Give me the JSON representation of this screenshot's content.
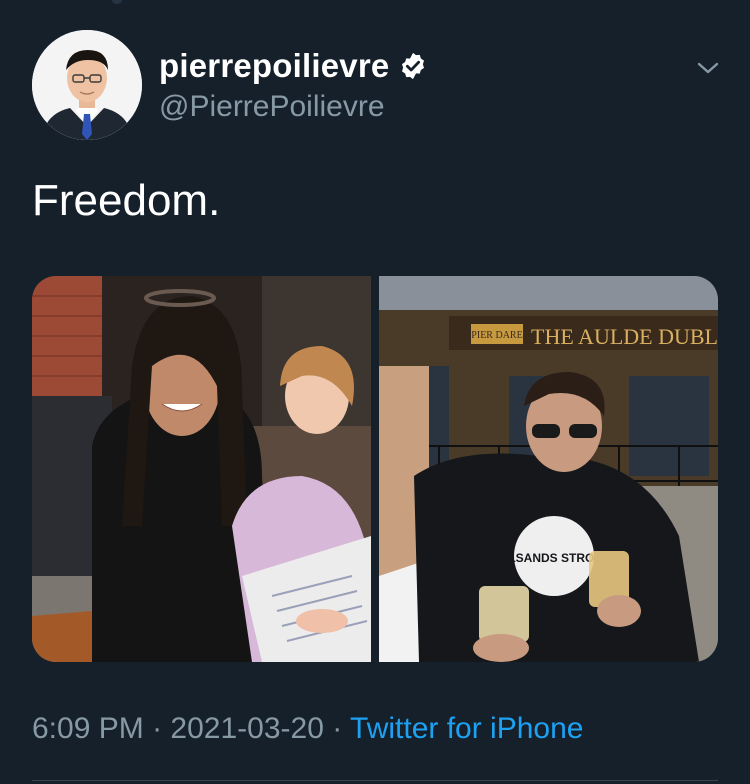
{
  "tweet": {
    "display_name": "pierrepoilievre",
    "handle": "@PierrePoilievre",
    "text": "Freedom.",
    "time": "6:09 PM",
    "separator": "·",
    "date": "2021-03-20",
    "source": "Twitter for iPhone",
    "verified": true
  },
  "photos": {
    "right_sign": "THE AULDE DUBLIN",
    "right_small_sign": "PIER DARE",
    "hoodie_text": "OILSANDS STRONG"
  },
  "icons": {
    "verified": "verified-badge-icon",
    "caret": "chevron-down-icon"
  },
  "colors": {
    "background": "#15202b",
    "secondary_text": "#8899a6",
    "link": "#1da1f2",
    "divider": "#38444d"
  }
}
